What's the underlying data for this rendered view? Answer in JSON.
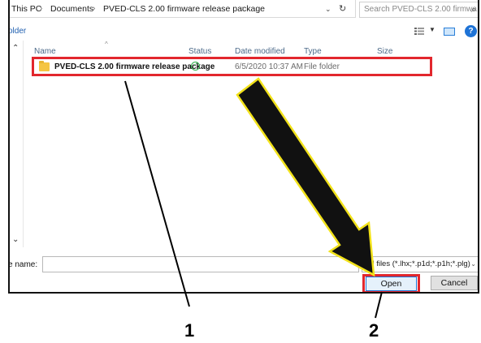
{
  "breadcrumb": {
    "items": [
      "This PC",
      "Documents",
      "PVED-CLS 2.00 firmware release package"
    ],
    "separator": "›"
  },
  "search": {
    "placeholder": "Search PVED-CLS 2.00 firmwa..."
  },
  "toolbar": {
    "new_folder_label": "older"
  },
  "columns": [
    "Name",
    "Status",
    "Date modified",
    "Type",
    "Size"
  ],
  "files": [
    {
      "name": "PVED-CLS 2.00 firmware release package",
      "status": "synced",
      "date_modified": "6/5/2020 10:37 AM",
      "type": "File folder",
      "size": ""
    }
  ],
  "filename": {
    "label": "e name:",
    "value": ""
  },
  "filetype": {
    "selected": "All files (*.lhx;*.p1d;*.p1h;*.plg)"
  },
  "buttons": {
    "open": "Open",
    "cancel": "Cancel"
  },
  "callouts": [
    "1",
    "2"
  ],
  "colors": {
    "highlight": "#e2272d",
    "arrow_fill": "#111111",
    "arrow_outline": "#f2e21a",
    "accent": "#1e73d6"
  },
  "icons": [
    "folder-icon",
    "status-ok-icon",
    "refresh-icon",
    "search-icon",
    "view-options-icon",
    "preview-pane-icon",
    "help-icon"
  ]
}
